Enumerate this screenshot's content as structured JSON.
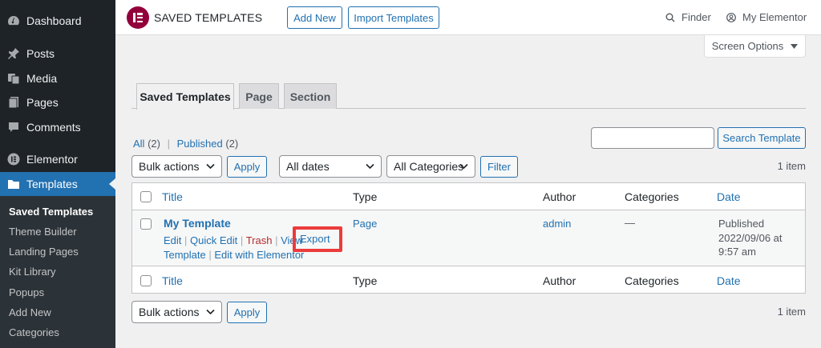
{
  "sidebar": {
    "items": [
      {
        "label": "Dashboard",
        "icon": "dashboard-icon"
      },
      {
        "label": "Posts",
        "icon": "pin-icon"
      },
      {
        "label": "Media",
        "icon": "media-icon"
      },
      {
        "label": "Pages",
        "icon": "page-icon"
      },
      {
        "label": "Comments",
        "icon": "comment-icon"
      },
      {
        "label": "Elementor",
        "icon": "elementor-icon"
      },
      {
        "label": "Templates",
        "icon": "folder-icon"
      }
    ],
    "submenu": [
      "Saved Templates",
      "Theme Builder",
      "Landing Pages",
      "Kit Library",
      "Popups",
      "Add New",
      "Categories"
    ]
  },
  "header": {
    "title": "SAVED TEMPLATES",
    "add_new": "Add New",
    "import": "Import Templates",
    "finder": "Finder",
    "my_elementor": "My Elementor",
    "brand_color": "#92003b"
  },
  "screen_options": "Screen Options",
  "tabs": [
    "Saved Templates",
    "Page",
    "Section"
  ],
  "views": {
    "all": "All",
    "all_count": "(2)",
    "separator": "|",
    "published": "Published",
    "published_count": "(2)"
  },
  "search": {
    "button": "Search Template"
  },
  "filters": {
    "bulk_actions": "Bulk actions",
    "apply": "Apply",
    "dates": "All dates",
    "categories": "All Categories",
    "filter": "Filter",
    "count": "1 item"
  },
  "table": {
    "headers": [
      "Title",
      "Type",
      "Author",
      "Categories",
      "Date"
    ],
    "row": {
      "title": "My Template",
      "type": "Page",
      "author": "admin",
      "categories": "—",
      "date_status": "Published",
      "date_value": "2022/09/06 at",
      "date_time": "9:57 am",
      "actions": {
        "edit": "Edit",
        "quick_edit": "Quick Edit",
        "trash": "Trash",
        "view": "View",
        "export": "Export",
        "export_suffix": "Template",
        "edit_elementor": "Edit with Elementor",
        "sep": "|"
      }
    }
  },
  "highlight_color": "#ec3b3b"
}
